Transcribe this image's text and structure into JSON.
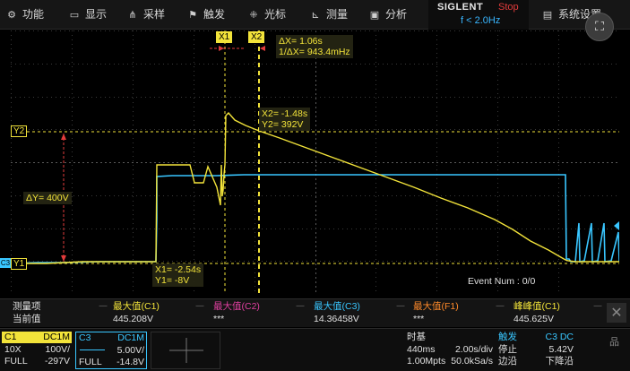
{
  "menu": {
    "items": [
      {
        "label": "功能",
        "icon": "gear-icon",
        "glyph": "⚙"
      },
      {
        "label": "显示",
        "icon": "display-icon",
        "glyph": "▭"
      },
      {
        "label": "采样",
        "icon": "acquire-icon",
        "glyph": "⋔"
      },
      {
        "label": "触发",
        "icon": "trigger-flag-icon",
        "glyph": "⚑"
      },
      {
        "label": "光标",
        "icon": "cursor-icon",
        "glyph": "⁜"
      },
      {
        "label": "测量",
        "icon": "measure-icon",
        "glyph": "⊾"
      },
      {
        "label": "分析",
        "icon": "analysis-icon",
        "glyph": "▣"
      },
      {
        "label": "系统设置",
        "icon": "system-icon",
        "glyph": "▤"
      }
    ],
    "brand": "SIGLENT",
    "run_state": "Stop",
    "freq": "f < 2.0Hz",
    "screen_button_glyph": "⛶"
  },
  "cursors": {
    "x1_tag": "X1",
    "x2_tag": "X2",
    "y1_tag": "Y1",
    "y2_tag": "Y2",
    "delta_x": "ΔX= 1.06s",
    "inv_delta_x": "1/ΔX= 943.4mHz",
    "x2_time": "X2= -1.48s",
    "y2_value": "Y2= 392V",
    "x1_time": "X1= -2.54s",
    "y1_value": "Y1= -8V",
    "delta_y": "ΔY= 400V"
  },
  "event_num": "Event Num : 0/0",
  "channel_marker": "C3",
  "measure": {
    "row_label_1": "测量项",
    "row_label_2": "当前值",
    "columns": [
      {
        "title": "最大值(C1)",
        "value": "445.208V",
        "color": "#f2e33a"
      },
      {
        "title": "最大值(C2)",
        "value": "***",
        "color": "#e040a0"
      },
      {
        "title": "最大值(C3)",
        "value": "14.36458V",
        "color": "#39c6ff"
      },
      {
        "title": "最大值(F1)",
        "value": "***",
        "color": "#ff8a2a"
      },
      {
        "title": "峰峰值(C1)",
        "value": "445.625V",
        "color": "#f2e33a"
      }
    ],
    "close_glyph": "✕"
  },
  "status": {
    "c1": {
      "name": "C1",
      "coupling": "DC1M",
      "probe": "10X",
      "scale": "100V/",
      "bw": "FULL",
      "offset": "-297V"
    },
    "c3": {
      "name": "C3",
      "coupling": "DC1M",
      "scale": "5.00V/",
      "bw": "FULL",
      "offset": "-14.8V"
    },
    "timebase": {
      "title": "时基",
      "delay": "440ms",
      "scale": "2.00s/div",
      "mpts": "1.00Mpts",
      "rate": "50.0kSa/s"
    },
    "trigger": {
      "title": "触发",
      "source": "C3 DC",
      "mode": "停止",
      "level": "5.42V",
      "edge_label": "边沿",
      "slope": "下降沿"
    }
  },
  "colors": {
    "ch1": "#f2e33a",
    "ch3": "#39c6ff",
    "stop": "#e23b3b"
  }
}
